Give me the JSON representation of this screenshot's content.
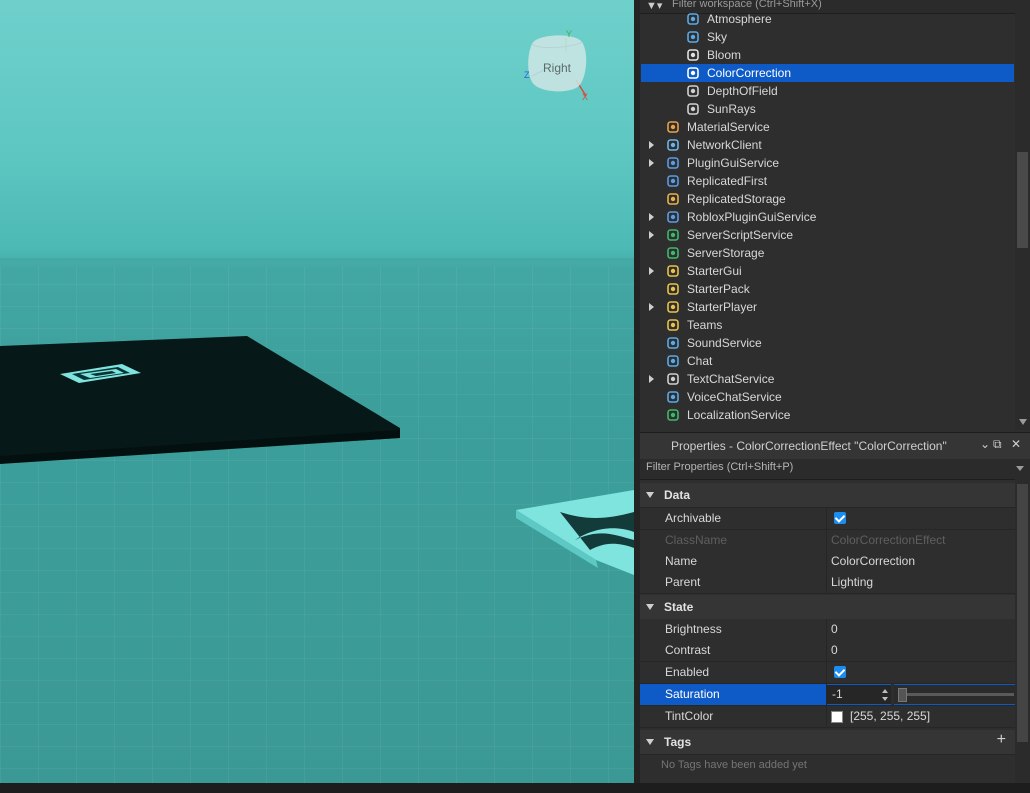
{
  "viewport": {
    "gizmo_label": "Right",
    "axis_y": "Y",
    "axis_z": "Z",
    "axis_x": "X",
    "colors": {
      "sky": "#6fd0cb",
      "floor": "#3b9995",
      "platform": "#061818",
      "accent": "#7fe3de"
    }
  },
  "explorer": {
    "filter_placeholder": "Filter workspace (Ctrl+Shift+X)",
    "items": [
      {
        "label": "Atmosphere",
        "icon": "atmosphere-icon",
        "level": 2,
        "expandable": false
      },
      {
        "label": "Sky",
        "icon": "sky-icon",
        "level": 2,
        "expandable": false
      },
      {
        "label": "Bloom",
        "icon": "bloom-icon",
        "level": 2,
        "expandable": false
      },
      {
        "label": "ColorCorrection",
        "icon": "color-correction-icon",
        "level": 2,
        "expandable": false,
        "selected": true
      },
      {
        "label": "DepthOfField",
        "icon": "depth-of-field-icon",
        "level": 2,
        "expandable": false
      },
      {
        "label": "SunRays",
        "icon": "sun-rays-icon",
        "level": 2,
        "expandable": false
      },
      {
        "label": "MaterialService",
        "icon": "material-service-icon",
        "level": 1,
        "expandable": false
      },
      {
        "label": "NetworkClient",
        "icon": "network-client-icon",
        "level": 1,
        "expandable": true
      },
      {
        "label": "PluginGuiService",
        "icon": "plugin-gui-service-icon",
        "level": 1,
        "expandable": true
      },
      {
        "label": "ReplicatedFirst",
        "icon": "replicated-first-icon",
        "level": 1,
        "expandable": false
      },
      {
        "label": "ReplicatedStorage",
        "icon": "replicated-storage-icon",
        "level": 1,
        "expandable": false
      },
      {
        "label": "RobloxPluginGuiService",
        "icon": "roblox-plugin-gui-service-icon",
        "level": 1,
        "expandable": true
      },
      {
        "label": "ServerScriptService",
        "icon": "server-script-service-icon",
        "level": 1,
        "expandable": true
      },
      {
        "label": "ServerStorage",
        "icon": "server-storage-icon",
        "level": 1,
        "expandable": false
      },
      {
        "label": "StarterGui",
        "icon": "starter-gui-icon",
        "level": 1,
        "expandable": true
      },
      {
        "label": "StarterPack",
        "icon": "starter-pack-icon",
        "level": 1,
        "expandable": false
      },
      {
        "label": "StarterPlayer",
        "icon": "starter-player-icon",
        "level": 1,
        "expandable": true
      },
      {
        "label": "Teams",
        "icon": "teams-icon",
        "level": 1,
        "expandable": false
      },
      {
        "label": "SoundService",
        "icon": "sound-service-icon",
        "level": 1,
        "expandable": false
      },
      {
        "label": "Chat",
        "icon": "chat-icon",
        "level": 1,
        "expandable": false
      },
      {
        "label": "TextChatService",
        "icon": "text-chat-service-icon",
        "level": 1,
        "expandable": true
      },
      {
        "label": "VoiceChatService",
        "icon": "voice-chat-service-icon",
        "level": 1,
        "expandable": false
      },
      {
        "label": "LocalizationService",
        "icon": "localization-service-icon",
        "level": 1,
        "expandable": false
      }
    ]
  },
  "properties": {
    "title": "Properties - ColorCorrectionEffect \"ColorCorrection\"",
    "filter_placeholder": "Filter Properties (Ctrl+Shift+P)",
    "sections": {
      "data": "Data",
      "state": "State",
      "tags": "Tags"
    },
    "rows": {
      "archivable": {
        "name": "Archivable",
        "checked": true
      },
      "classname": {
        "name": "ClassName",
        "value": "ColorCorrectionEffect"
      },
      "name": {
        "name": "Name",
        "value": "ColorCorrection"
      },
      "parent": {
        "name": "Parent",
        "value": "Lighting"
      },
      "brightness": {
        "name": "Brightness",
        "value": "0"
      },
      "contrast": {
        "name": "Contrast",
        "value": "0"
      },
      "enabled": {
        "name": "Enabled",
        "checked": true
      },
      "saturation": {
        "name": "Saturation",
        "value": "-1",
        "slider_fraction": 0
      },
      "tintcolor": {
        "name": "TintColor",
        "value": "[255, 255, 255]",
        "swatch": "#ffffff"
      }
    },
    "no_tags": "No Tags have been added yet"
  }
}
